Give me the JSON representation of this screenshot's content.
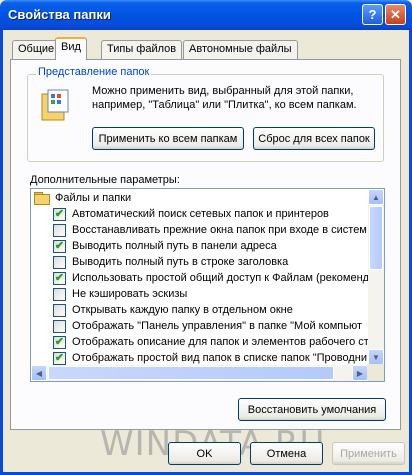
{
  "window": {
    "title": "Свойства папки",
    "help_button": "?",
    "close_button": "✕"
  },
  "tabs": [
    {
      "label": "Общие",
      "active": false
    },
    {
      "label": "Вид",
      "active": true
    },
    {
      "label": "Типы файлов",
      "active": false
    },
    {
      "label": "Автономные файлы",
      "active": false
    }
  ],
  "folder_views": {
    "group_title": "Представление папок",
    "description": "Можно применить вид, выбранный для этой папки, например, \"Таблица\" или \"Плитка\", ко всем папкам.",
    "apply_all_label": "Применить ко всем папкам",
    "reset_all_label": "Сброс для всех папок"
  },
  "advanced": {
    "label": "Дополнительные параметры:",
    "root": "Файлы и папки",
    "items": [
      {
        "label": "Автоматический поиск сетевых папок и принтеров",
        "checked": true
      },
      {
        "label": "Восстанавливать прежние окна папок при входе в систем",
        "checked": false
      },
      {
        "label": "Выводить полный путь в панели адреса",
        "checked": true
      },
      {
        "label": "Выводить полный путь в строке заголовка",
        "checked": false
      },
      {
        "label": "Использовать простой общий доступ к Файлам (рекоменд",
        "checked": true
      },
      {
        "label": "Не кэшировать эскизы",
        "checked": false
      },
      {
        "label": "Открывать каждую папку в отдельном окне",
        "checked": false
      },
      {
        "label": "Отображать \"Панель управления\" в папке \"Мой компьют",
        "checked": false
      },
      {
        "label": "Отображать описание для папок и элементов рабочего ст",
        "checked": true
      },
      {
        "label": "Отображать простой вид папок в списке папок \"Проводни",
        "checked": true
      }
    ],
    "restore_defaults_label": "Восстановить умолчания"
  },
  "footer": {
    "ok_label": "OK",
    "cancel_label": "Отмена",
    "apply_label": "Применить"
  },
  "watermark": "WINDATA.RU",
  "check_glyph": "✔"
}
